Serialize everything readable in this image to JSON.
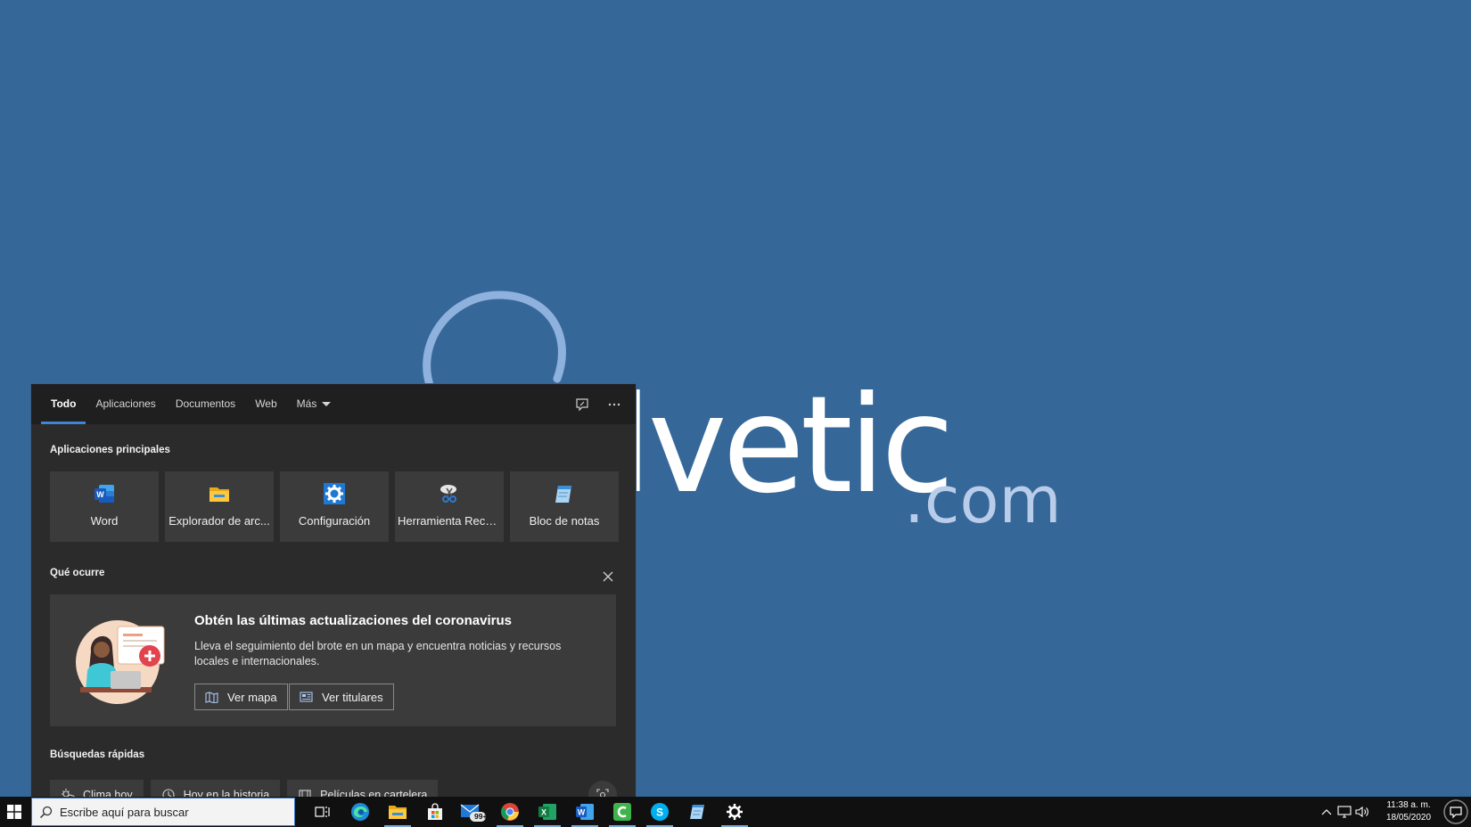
{
  "wallpaper": {
    "brand": "lvetic",
    "domain": ".com"
  },
  "tabs": [
    {
      "label": "Todo",
      "active": true
    },
    {
      "label": "Aplicaciones"
    },
    {
      "label": "Documentos"
    },
    {
      "label": "Web"
    },
    {
      "label": "Más"
    }
  ],
  "top_apps": {
    "title": "Aplicaciones principales",
    "items": [
      {
        "label": "Word",
        "icon": "word-icon"
      },
      {
        "label": "Explorador de arc...",
        "icon": "file-explorer-icon"
      },
      {
        "label": "Configuración",
        "icon": "settings-gear-icon"
      },
      {
        "label": "Herramienta Reco...",
        "icon": "snipping-tool-icon"
      },
      {
        "label": "Bloc de notas",
        "icon": "notepad-icon"
      }
    ]
  },
  "news": {
    "section_title": "Qué ocurre",
    "title": "Obtén las últimas actualizaciones del coronavirus",
    "description": "Lleva el seguimiento del brote en un mapa y encuentra noticias y recursos locales e internacionales.",
    "buttons": [
      {
        "label": "Ver mapa",
        "icon": "map-icon"
      },
      {
        "label": "Ver titulares",
        "icon": "newspaper-icon"
      }
    ]
  },
  "quick_searches": {
    "title": "Búsquedas rápidas",
    "items": [
      {
        "label": "Clima hoy",
        "icon": "weather-icon"
      },
      {
        "label": "Hoy en la historia",
        "icon": "clock-icon"
      },
      {
        "label": "Películas en cartelera",
        "icon": "film-icon"
      }
    ]
  },
  "taskbar": {
    "search_placeholder": "Escribe aquí para buscar",
    "mail_badge": "99+",
    "clock": {
      "time": "11:38 a. m.",
      "date": "18/05/2020"
    }
  },
  "colors": {
    "desktop": "#356899",
    "panel": "#2b2b2b",
    "panel_header": "#1f1f1f",
    "tile": "#3b3b3b",
    "accent": "#3f85d6",
    "taskbar": "#101010"
  }
}
